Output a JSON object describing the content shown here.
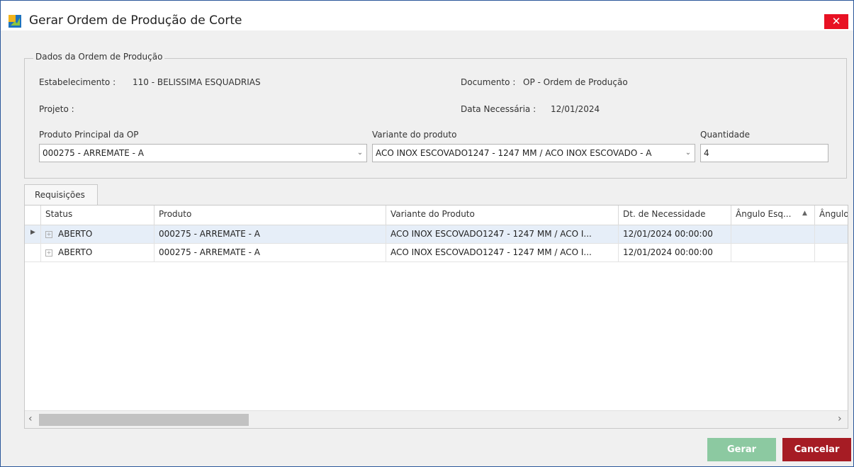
{
  "window": {
    "title": "Gerar Ordem de Produção de Corte",
    "close_glyph": "✕"
  },
  "group": {
    "legend": "Dados da Ordem de Produção",
    "estabelecimento_label": "Estabelecimento :",
    "estabelecimento_value": "110 - BELISSIMA ESQUADRIAS",
    "documento_label": "Documento :",
    "documento_value": "OP - Ordem de Produção",
    "projeto_label": "Projeto :",
    "data_label": "Data Necessária :",
    "data_value": "12/01/2024",
    "produto_label": "Produto Principal da OP",
    "produto_value": "000275 - ARREMATE - A",
    "variante_label": "Variante do produto",
    "variante_value": "ACO INOX ESCOVADO1247 - 1247 MM / ACO INOX ESCOVADO - A",
    "quantidade_label": "Quantidade",
    "quantidade_value": "4"
  },
  "tab": {
    "label": "Requisições"
  },
  "grid": {
    "columns": [
      "Status",
      "Produto",
      "Variante do Produto",
      "Dt. de Necessidade",
      "Ângulo Esq...",
      "Ângulo"
    ],
    "sort_glyph": "▲",
    "rows": [
      {
        "status": "ABERTO",
        "produto": "000275 - ARREMATE - A",
        "variante": "ACO INOX ESCOVADO1247 - 1247 MM / ACO I...",
        "dt": "12/01/2024 00:00:00",
        "selected": true
      },
      {
        "status": "ABERTO",
        "produto": "000275 - ARREMATE - A",
        "variante": "ACO INOX ESCOVADO1247 - 1247 MM / ACO I...",
        "dt": "12/01/2024 00:00:00",
        "selected": false
      }
    ]
  },
  "buttons": {
    "gerar": "Gerar",
    "cancelar": "Cancelar"
  },
  "colors": {
    "accent_close": "#e81123",
    "gerar": "#8cc9a1",
    "cancelar": "#a61c24",
    "selected_row": "#e6eef8"
  }
}
